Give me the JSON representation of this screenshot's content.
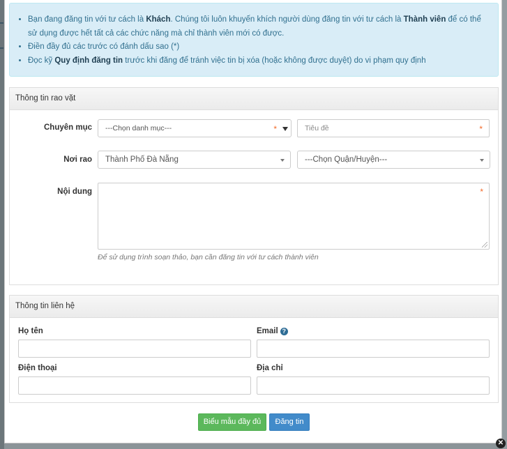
{
  "alert": {
    "line1_a": "Bạn đang đăng tin với tư cách là ",
    "line1_b": "Khách",
    "line1_c": ". Chúng tôi luôn khuyến khích người dùng đăng tin với tư cách là ",
    "line1_d": "Thành viên",
    "line1_e": " để có thể sử dụng được hết tất cả các chức năng mà chỉ thành viên mới có được.",
    "line2": "Điền đầy đủ các trước có đánh dấu sao (*)",
    "line3_a": "Đọc kỹ ",
    "line3_b": "Quy định đăng tin",
    "line3_c": " trước khi đăng để tránh việc tin bị xóa (hoặc không được duyệt) do vi phạm quy định"
  },
  "listing_panel": {
    "title": "Thông tin rao vặt",
    "category_label": "Chuyên mục",
    "category_value": "---Chọn danh mục---",
    "title_placeholder": "Tiêu đề",
    "location_label": "Nơi rao",
    "city_value": "Thành Phố Đà Nẵng",
    "district_value": "---Chọn Quận/Huyện---",
    "content_label": "Nội dung",
    "content_hint": "Để sử dụng trình soạn thảo, bạn cần đăng tin với tư cách thành viên",
    "required_mark": "*"
  },
  "contact_panel": {
    "title": "Thông tin liên hệ",
    "name_label": "Họ tên",
    "email_label": "Email",
    "phone_label": "Điện thoại",
    "address_label": "Địa chỉ",
    "help_icon_glyph": "?"
  },
  "buttons": {
    "full_form": "Biểu mẫu đầy đủ",
    "submit": "Đăng tin"
  },
  "colors": {
    "alert_bg": "#d9edf7",
    "success": "#5cb85c",
    "primary": "#428bca",
    "required": "#f26b2a"
  }
}
